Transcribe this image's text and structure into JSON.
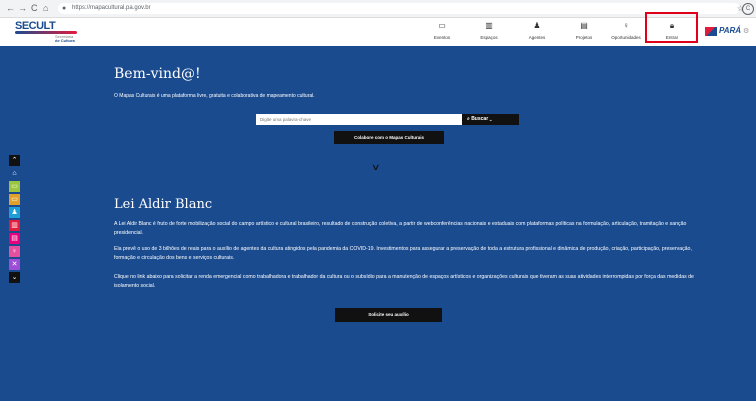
{
  "browser": {
    "back": "←",
    "forward": "→",
    "reload": "C",
    "home": "⌂",
    "url": "https://mapacultural.pa.gov.br",
    "star": "☆",
    "profile": "C"
  },
  "header": {
    "logo": {
      "brand": "SECULT",
      "sub1": "Secretaria",
      "sub2": "de Cultura"
    },
    "menu": [
      {
        "label": "Eventos",
        "icon": "calendar-icon",
        "glyph": "▭"
      },
      {
        "label": "Espaços",
        "icon": "building-icon",
        "glyph": "▥"
      },
      {
        "label": "Agentes",
        "icon": "person-icon",
        "glyph": "♟"
      },
      {
        "label": "Projetos",
        "icon": "projects-icon",
        "glyph": "▤"
      },
      {
        "label": "Oportunidades",
        "icon": "lightbulb-icon",
        "glyph": "♀"
      },
      {
        "label": "Entrar",
        "icon": "lock-icon",
        "glyph": "🔒︎"
      }
    ],
    "state_logo": "PARÁ",
    "gear": "⚙"
  },
  "left_rail": [
    {
      "name": "scroll-up",
      "glyph": "⌃",
      "color": "#111111"
    },
    {
      "name": "home",
      "glyph": "⌂",
      "color": "#1a4b8f"
    },
    {
      "name": "events",
      "glyph": "▭",
      "color": "#9bc53d"
    },
    {
      "name": "spaces",
      "glyph": "▭",
      "color": "#e0a02a"
    },
    {
      "name": "agents",
      "glyph": "♟",
      "color": "#1d9ed8"
    },
    {
      "name": "projects",
      "glyph": "▥",
      "color": "#e31b3c"
    },
    {
      "name": "opportunities-list",
      "glyph": "▤",
      "color": "#e6007e"
    },
    {
      "name": "opportunities",
      "glyph": "♀",
      "color": "#e64ea0"
    },
    {
      "name": "tools",
      "glyph": "✕",
      "color": "#9c4fd6"
    },
    {
      "name": "scroll-down",
      "glyph": "⌄",
      "color": "#111111"
    }
  ],
  "hero": {
    "title": "Bem-vind@!",
    "description": "O Mapas Culturais é uma plataforma livre, gratuita e colaborativa de mapeamento cultural.",
    "search_placeholder": "Digite uma palavra-chave",
    "search_button": "⌕ Buscar ⌄",
    "collaborate_button": "Colabore com o Mapas Culturais",
    "scroll_chevron": "∨"
  },
  "aldir": {
    "title": "Lei Aldir Blanc",
    "p1": "A Lei Aldir Blanc é fruto de forte mobilização social do campo artístico e cultural brasileiro, resultado de construção coletiva, a partir de webconferências nacionais e estaduais com plataformas políticas na formulação, articulação, tramitação e sanção presidencial.",
    "p2": "Ela prevê o uso de 3 bilhões de reais para o auxílio de agentes da cultura atingidos pela pandemia da COVID-19. Investimentos para assegurar a preservação de toda a estrutura profissional e dinâmica de produção, criação, participação, preservação, formação e circulação dos bens e serviços culturais.",
    "p3": "Clique no link abaixo para solicitar a renda emergencial como trabalhadora e trabalhador da cultura ou o subsídio para a manutenção de espaços artísticos e organizações culturais que tiveram as suas atividades interrompidas por força das medidas de isolamento social.",
    "button": "Solicite seu auxílio"
  },
  "colors": {
    "page_background": "#1a4b8f",
    "highlight_box": "#e0001a"
  }
}
